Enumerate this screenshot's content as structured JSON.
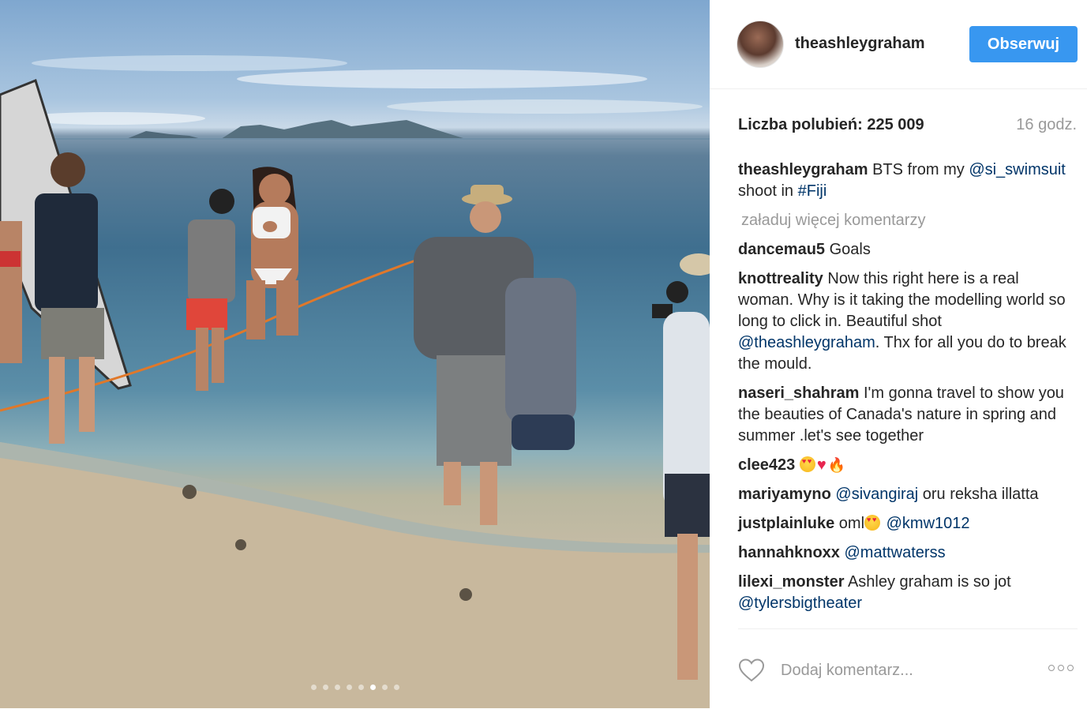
{
  "post": {
    "username": "theashleygraham",
    "follow_label": "Obserwuj",
    "likes_text": "Liczba polubień: 225 009",
    "time": "16 godz.",
    "caption": {
      "user": "theashleygraham",
      "text_1": " BTS from my ",
      "mention": "@si_swimsuit",
      "text_2": " shoot in ",
      "hashtag": "#Fiji"
    },
    "load_more": "załaduj więcej komentarzy",
    "comments": [
      {
        "user": "dancemau5",
        "text": " Goals"
      },
      {
        "user": "knottreality",
        "text": " Now this right here is a real woman. Why is it taking the modelling world so long to click in. Beautiful shot ",
        "mention": "@theashleygraham",
        "text_after": ". Thx for all you do to break the mould."
      },
      {
        "user": "naseri_shahram",
        "text": " I'm gonna travel to show you the beauties of Canada's nature in spring and summer .let's see together"
      },
      {
        "user": "clee423",
        "text": " "
      },
      {
        "user": "mariyamyno",
        "mention": "@sivangiraj",
        "text_after": " oru reksha illatta"
      },
      {
        "user": "justplainluke",
        "text": " oml",
        "mention": "@kmw1012"
      },
      {
        "user": "hannahknoxx",
        "mention": "@mattwaterss"
      },
      {
        "user": "lilexi_monster",
        "text": " Ashley graham is so jot ",
        "mention": "@tylersbigtheater"
      }
    ],
    "add_comment_placeholder": "Dodaj komentarz...",
    "carousel": {
      "count": 8,
      "active_index": 5
    }
  },
  "icons": {
    "like": "heart-outline-icon",
    "more": "more-options-icon",
    "avatar": "profile-avatar"
  },
  "colors": {
    "follow_button": "#3897f0",
    "link": "#003569",
    "muted": "#999999",
    "text": "#262626"
  }
}
